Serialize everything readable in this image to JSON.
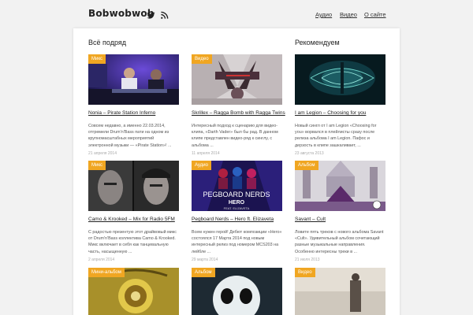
{
  "header": {
    "logo": "Bobwobwob",
    "nav": [
      "Аудио",
      "Видео",
      "О сайте"
    ]
  },
  "sections": {
    "all": "Всё подряд",
    "recommended": "Рекомендуем"
  },
  "colors": {
    "accent": "#f0a622"
  },
  "items": [
    {
      "badge": "Микс",
      "title": "Nonia – Pirate Station Inferno",
      "desc": "Совсем недавно, а именно 22.03.2014, отгремели Drum'n'Bass пати на одном из крупномасштабных мероприятий электронной музыки — «Pirate Station»! ...",
      "date": "21 апреля 2014"
    },
    {
      "badge": "Видео",
      "title": "Skrillex – Ragga Bomb with Ragga Twins",
      "desc": "Интересный подход к сценарию для видео-клипа, «Darth Vader» был бы рад. В данном клипе представлен видео-ряд к синглу, с альбома ...",
      "date": "11 апреля 2014"
    },
    {
      "badge": "",
      "title": "I am Legion – Choosing for you",
      "desc": "Новый сингл от I am Legion «Choosing for you» ворвался в плейлисты сразу после релиза альбома I am Legion. Пафос и дерзость в клипе зашкаливает, ...",
      "date": "23 августа 2013"
    },
    {
      "badge": "Микс",
      "title": "Camo & Krooked – Mix for Radio 5FM",
      "desc": "С радостью презентую этот драйвовый микс от Drum'n'Bass коллектива Camo & Krooked. Микс включает в себя как танцевальную часть, насыщенную ...",
      "date": "2 апреля 2014"
    },
    {
      "badge": "Аудио",
      "title": "Pegboard Nerds – Hero ft. Elizaveta",
      "desc": "Всем нужен герой! Дебют композиции «Hero» состоялся 17 Марта 2014 под новым интересный релиз под номером MCS203 на лейбле ...",
      "date": "29 марта 2014"
    },
    {
      "badge": "Альбом",
      "title": "Savant – Cult",
      "desc": "Ловите пять треков с нового альбома Savant «Cult». Удивительный альбом сочетающий разные музыкальные направления. Особенно интересны треки в ...",
      "date": "21 июля 2013"
    },
    {
      "badge": "Мини-альбом",
      "title": "",
      "desc": "",
      "date": ""
    },
    {
      "badge": "Альбом",
      "title": "",
      "desc": "",
      "date": ""
    },
    {
      "badge": "Видео",
      "title": "",
      "desc": "",
      "date": ""
    }
  ],
  "thumb_texts": {
    "pegboard_name": "PEGBOARD NERDS",
    "pegboard_track": "HERO",
    "pegboard_feat": "FEAT. ELIZAVETA"
  },
  "icons": [
    "twitter-icon",
    "rss-icon"
  ]
}
